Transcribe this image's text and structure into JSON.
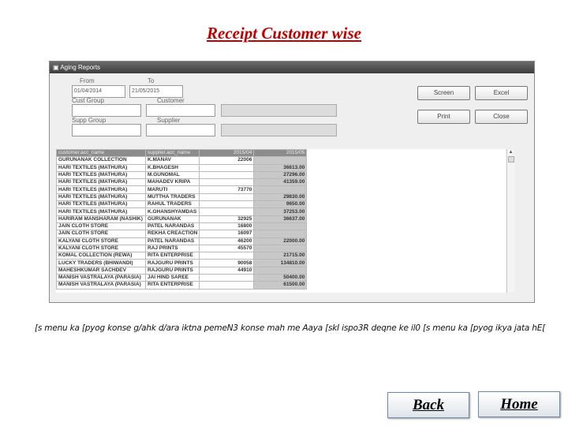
{
  "page_title": "Receipt Customer wise",
  "window": {
    "title": "Aging Reports",
    "from_label": "From",
    "from_value": "01/04/2014",
    "to_label": "To",
    "to_value": "21/05/2015",
    "cust_group_label": "Cust Group",
    "customer_label": "Customer",
    "supp_group_label": "Supp Group",
    "supplier_label": "Supplier",
    "buttons": {
      "screen": "Screen",
      "excel": "Excel",
      "print": "Print",
      "close": "Close"
    },
    "table": {
      "headers": [
        "customer.acc_name",
        "supplier.acc_name",
        "2015/04",
        "2015/05"
      ],
      "rows": [
        [
          "GURUNANAK COLLECTION",
          "K.MANAV",
          "22006",
          ""
        ],
        [
          "HARI TEXTILES (MATHURA)",
          "K.BHAGESH",
          "",
          "36613.00"
        ],
        [
          "HARI TEXTILES (MATHURA)",
          "M.GUNOMAL",
          "",
          "27296.00"
        ],
        [
          "HARI TEXTILES (MATHURA)",
          "MAHADEV KRIPA",
          "",
          "41359.00"
        ],
        [
          "HARI TEXTILES (MATHURA)",
          "MARUTI",
          "73770",
          ""
        ],
        [
          "HARI TEXTILES (MATHURA)",
          "MUTTHA TRADERS",
          "",
          "29830.00"
        ],
        [
          "HARI TEXTILES (MATHURA)",
          "RAHUL TRADERS",
          "",
          "9650.00"
        ],
        [
          "HARI TEXTILES (MATHURA)",
          "K.GHANSHYAMDAS",
          "",
          "37253.00"
        ],
        [
          "HARIRAM MANSHARAM (NASHIK)",
          "GURUNANAK",
          "32925",
          "36637.00"
        ],
        [
          "JAIN CLOTH STORE",
          "PATEL NARANDAS",
          "16800",
          ""
        ],
        [
          "JAIN CLOTH STORE",
          "REKHA CREACTION",
          "16097",
          ""
        ],
        [
          "KALYANI CLOTH STORE",
          "PATEL NARANDAS",
          "46200",
          "22000.00"
        ],
        [
          "KALYANI CLOTH STORE",
          "RAJ PRINTS",
          "45570",
          ""
        ],
        [
          "KOMAL COLLECTION (REWA)",
          "RITA ENTERPRISE",
          "",
          "21715.00"
        ],
        [
          "LUCKY TRADERS (BHIWANDI)",
          "RAJGURU PRINTS",
          "90058",
          "134810.00"
        ],
        [
          "MAHESHKUMAR SACHDEV",
          "RAJGURU PRINTS",
          "44910",
          ""
        ],
        [
          "MANISH VASTRALAYA (PARASIA)",
          "JAI HIND SAREE",
          "",
          "50400.00"
        ],
        [
          "MANISH VASTRALAYA (PARASIA)",
          "RITA ENTERPRISE",
          "",
          "61500.00"
        ]
      ]
    }
  },
  "note": "[s menu ka [pyog konse g/ahk d/ara iktna pemeN3 konse mah me Aaya [skI ispo3R deqne ke il0 [s menu ka [pyog ikya jata hE[",
  "nav": {
    "back": "Back",
    "home": "Home"
  },
  "colors": {
    "title": "#c00000"
  }
}
